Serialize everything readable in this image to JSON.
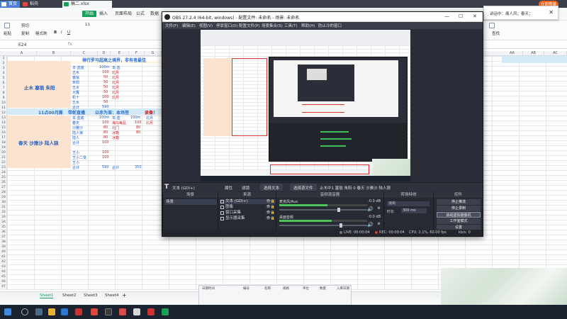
{
  "browser_tabs": [
    {
      "label": "首页",
      "color": "#ffffff"
    },
    {
      "label": "稻壳",
      "color": "#e04646"
    },
    {
      "label": "稿二.xlsx",
      "color": "#18a058"
    }
  ],
  "menu": [
    "开始",
    "插入",
    "页面布局",
    "公式",
    "数据"
  ],
  "ribbon": {
    "paste": "粘贴",
    "cut": "剪切",
    "copy": "复制",
    "format_painter": "格式刷",
    "font_size": "11",
    "find": "查找"
  },
  "formula_bar": {
    "cell_ref": "E24",
    "fx": "fx"
  },
  "columns": [
    "A",
    "B",
    "C",
    "D",
    "E",
    "F",
    "G"
  ],
  "right_columns": [
    "AA",
    "AB",
    "AC"
  ],
  "rows": [
    "1",
    "2",
    "3",
    "4",
    "5",
    "6",
    "7",
    "8",
    "9",
    "10",
    "11",
    "12",
    "13",
    "14",
    "15",
    "16",
    "17",
    "18",
    "19",
    "20",
    "21",
    "22",
    "23",
    "24",
    "25",
    "26",
    "27",
    "28",
    "29",
    "30",
    "31",
    "32",
    "33",
    "34",
    "35",
    "36",
    "37",
    "38",
    "39",
    "40",
    "41",
    "42",
    "43",
    "44",
    "45",
    "46",
    "47"
  ],
  "sheet": {
    "title1": "禅行罗马超高之境界，非有者最佳",
    "group1": "止木 塞翁 朱阳",
    "title2": "11点00月撕",
    "title2b": "带蛇直播",
    "title2c": "以赤为准：本场签",
    "title2d": "录像！",
    "group2": "春天 沙雅沙 陆人狼",
    "col_c_top": [
      "本·蓝底",
      "五水",
      "塞翁",
      "朱阳",
      "五水",
      "大雁",
      "机十",
      "五水",
      "宝阳",
      "宝阳",
      "合计"
    ],
    "col_d_top": [
      "100m",
      "100",
      "50",
      "50",
      "50",
      "50",
      "100",
      "50",
      "50",
      "50",
      "590"
    ],
    "col_e_top": [
      "本·蓝",
      "北月",
      "北月",
      "北月",
      "北月",
      "北月",
      "北月",
      "北月",
      "北月"
    ],
    "col_c_bot": [
      "本·蓝底",
      "春天",
      "沙雅沙",
      "陆人狼",
      "陆人",
      "合计",
      "",
      "周期",
      "王小",
      "王小二变",
      "王小",
      "王小",
      "陆村",
      "合计"
    ],
    "col_d_bot": [
      "100m",
      "100",
      "80",
      "80",
      "80",
      "100",
      "",
      "100",
      "100",
      "100",
      "100",
      "100",
      "100",
      "590"
    ],
    "col_e_bot": [
      "本·蓝",
      "海马每品",
      "北门",
      "冰箱",
      "冰箱",
      "冰箱"
    ],
    "col_f_bot": [
      "100m",
      "100",
      "80",
      "80",
      "80"
    ],
    "col_g_bot": [
      "北月",
      "北月"
    ],
    "total_label": "合计",
    "total_value": "350"
  },
  "sheet_tabs": [
    "Sheet1",
    "Sheet2",
    "Sheet3",
    "Sheet4"
  ],
  "notification": {
    "text": "讲话中：痛人风；春天；"
  },
  "login_button": "立即登录",
  "bottom_table_headers": [
    "日期时间",
    "编号",
    "名称",
    "规格",
    "单位",
    "数量",
    "入库日期"
  ],
  "obs": {
    "title": "OBS 27.2.4 (64-bit, windows) - 配置文件: 未命名 - 场景: 未命名",
    "window_controls": [
      "—",
      "☐",
      "✕"
    ],
    "menu": [
      "文件(F)",
      "编辑(E)",
      "视图(V)",
      "停靠窗口(D)",
      "配置文件(P)",
      "场景集合(S)",
      "工具(T)",
      "帮助(H)",
      "防止冷的窗口"
    ],
    "source_bar": {
      "source_name": "文本 (GDI+)",
      "properties": "属性",
      "filters": "滤镜",
      "select_text": "选择文本",
      "select_file": "选择源文件",
      "text_preview": "止木中1 塞翁 朱阳 0 春天 沙雅沙 陆人狼"
    },
    "docks": {
      "scenes": "场景",
      "sources": "来源",
      "mixer": "音频混音器",
      "transitions": "转场特效",
      "controls": "控件"
    },
    "scene_items": [
      "场景"
    ],
    "sources": [
      {
        "name": "文本 (GDI+)"
      },
      {
        "name": "图像"
      },
      {
        "name": "窗口采集"
      },
      {
        "name": "显示器采集"
      }
    ],
    "mixer": [
      {
        "name": "麦克风/Aux",
        "db": "-0.0 dB",
        "level": 0.55,
        "volume": 0.68
      },
      {
        "name": "桌面音频",
        "db": "-0.0 dB",
        "level": 0.6,
        "volume": 0.7
      }
    ],
    "transitions": {
      "type_label": "淡出",
      "duration_label": "时长",
      "duration_value": "300 ms"
    },
    "controls": [
      "停止推流",
      "停止录制",
      "启动虚拟摄像机",
      "工作室模式",
      "设置",
      "退出"
    ],
    "status": {
      "live": "LIVE: 00:00:04",
      "rec": "REC: 00:00:04",
      "cpu": "CPU: 2.1%, 60.00 fps",
      "kbps": "kb/s: 0"
    },
    "dock_buttons": [
      "+",
      "—",
      "∧",
      "∨"
    ]
  },
  "taskbar": {
    "clock_time": "",
    "clock_date": ""
  }
}
